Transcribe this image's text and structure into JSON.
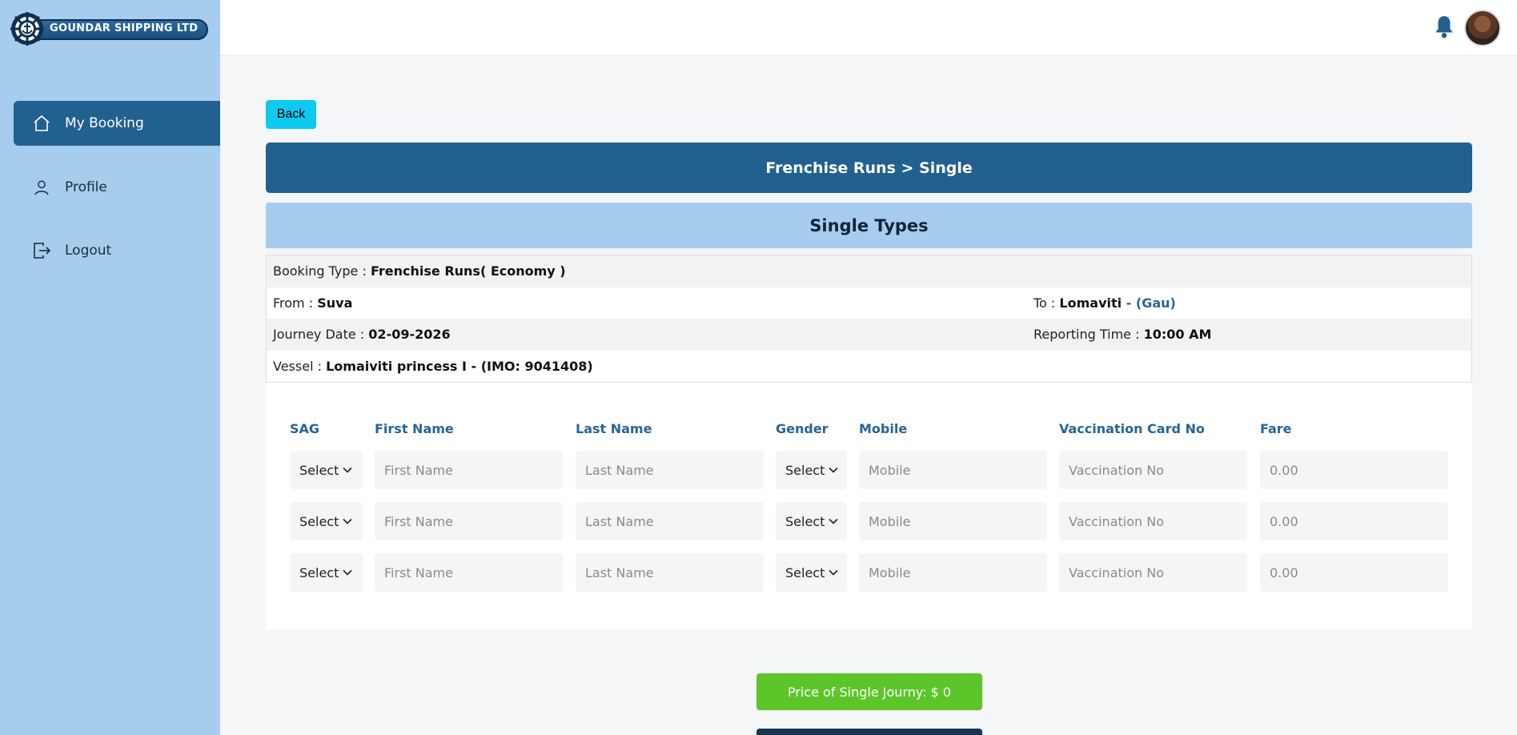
{
  "brand": {
    "name": "GOUNDAR SHIPPING LTD"
  },
  "sidebar": {
    "items": [
      {
        "label": "My Booking",
        "icon": "home-icon",
        "active": true
      },
      {
        "label": "Profile",
        "icon": "user-icon",
        "active": false
      },
      {
        "label": "Logout",
        "icon": "logout-icon",
        "active": false
      }
    ]
  },
  "topbar": {
    "bell_icon": "bell-icon",
    "avatar": "user-avatar"
  },
  "main": {
    "back_label": "Back",
    "title": "Frenchise Runs > Single",
    "subtitle": "Single Types",
    "info": {
      "booking_type_label": "Booking Type :",
      "booking_type_value": "Frenchise Runs( Economy )",
      "from_label": "From :",
      "from_value": "Suva",
      "to_label": "To :",
      "to_value": "Lomaviti",
      "to_suffix": " - (Gau)",
      "journey_date_label": "Journey Date :",
      "journey_date_value": "02-09-2026",
      "reporting_time_label": "Reporting Time :",
      "reporting_time_value": "10:00 AM",
      "vessel_label": "Vessel :",
      "vessel_value": "Lomaiviti princess I - (IMO: 9041408)"
    },
    "form": {
      "headers": {
        "sag": "SAG",
        "first_name": "First Name",
        "last_name": "Last Name",
        "gender": "Gender",
        "mobile": "Mobile",
        "vaccination": "Vaccination Card No",
        "fare": "Fare"
      },
      "rows": [
        {
          "sag": "Select",
          "first_name_placeholder": "First Name",
          "last_name_placeholder": "Last Name",
          "gender": "Select",
          "mobile_placeholder": "Mobile",
          "vaccination_placeholder": "Vaccination No",
          "fare": "0.00"
        },
        {
          "sag": "Select",
          "first_name_placeholder": "First Name",
          "last_name_placeholder": "Last Name",
          "gender": "Select",
          "mobile_placeholder": "Mobile",
          "vaccination_placeholder": "Vaccination No",
          "fare": "0.00"
        },
        {
          "sag": "Select",
          "first_name_placeholder": "First Name",
          "last_name_placeholder": "Last Name",
          "gender": "Select",
          "mobile_placeholder": "Mobile",
          "vaccination_placeholder": "Vaccination No",
          "fare": "0.00"
        }
      ]
    },
    "price_label": "Price of Single Journy: $ 0"
  },
  "colors": {
    "sidebar_bg": "#a6cdee",
    "primary": "#22608f",
    "back_button": "#0dcaf0",
    "price_button": "#5cc52a",
    "header_text": "#2a6496"
  }
}
